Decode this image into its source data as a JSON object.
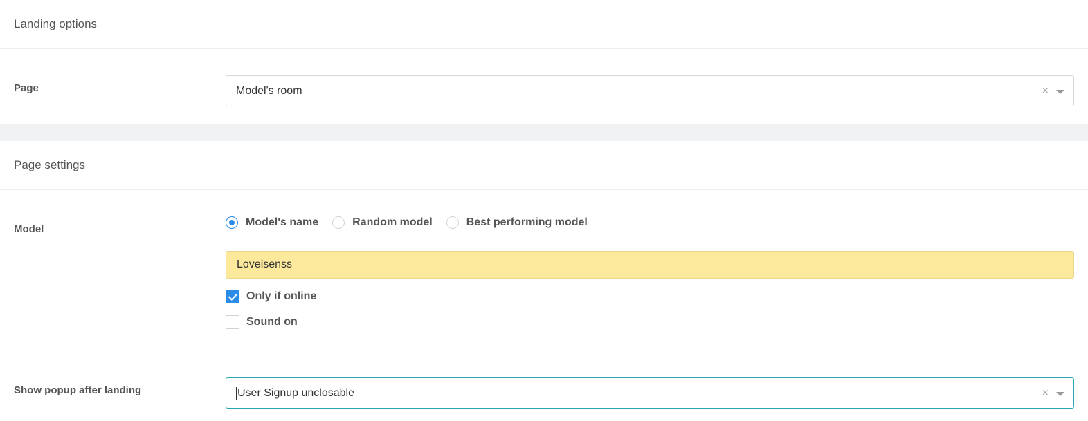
{
  "landing_options": {
    "title": "Landing options",
    "page": {
      "label": "Page",
      "value": "Model's room",
      "clear_glyph": "×"
    }
  },
  "page_settings": {
    "title": "Page settings",
    "model": {
      "label": "Model",
      "options": [
        "Model's name",
        "Random model",
        "Best performing model"
      ],
      "selected": "Model's name",
      "model_name_value": "Loveisenss",
      "only_if_online_label": "Only if online",
      "only_if_online_checked": true,
      "sound_on_label": "Sound on",
      "sound_on_checked": false
    },
    "popup": {
      "label": "Show popup after landing",
      "value": "User Signup unclosable",
      "clear_glyph": "×"
    }
  },
  "colors": {
    "accent_blue": "#2b8ce8",
    "highlight_yellow": "#fde99b",
    "focus_teal": "#2aa6b6"
  },
  "icons": [
    "clear-icon",
    "dropdown-arrow-icon",
    "checkmark-icon"
  ]
}
